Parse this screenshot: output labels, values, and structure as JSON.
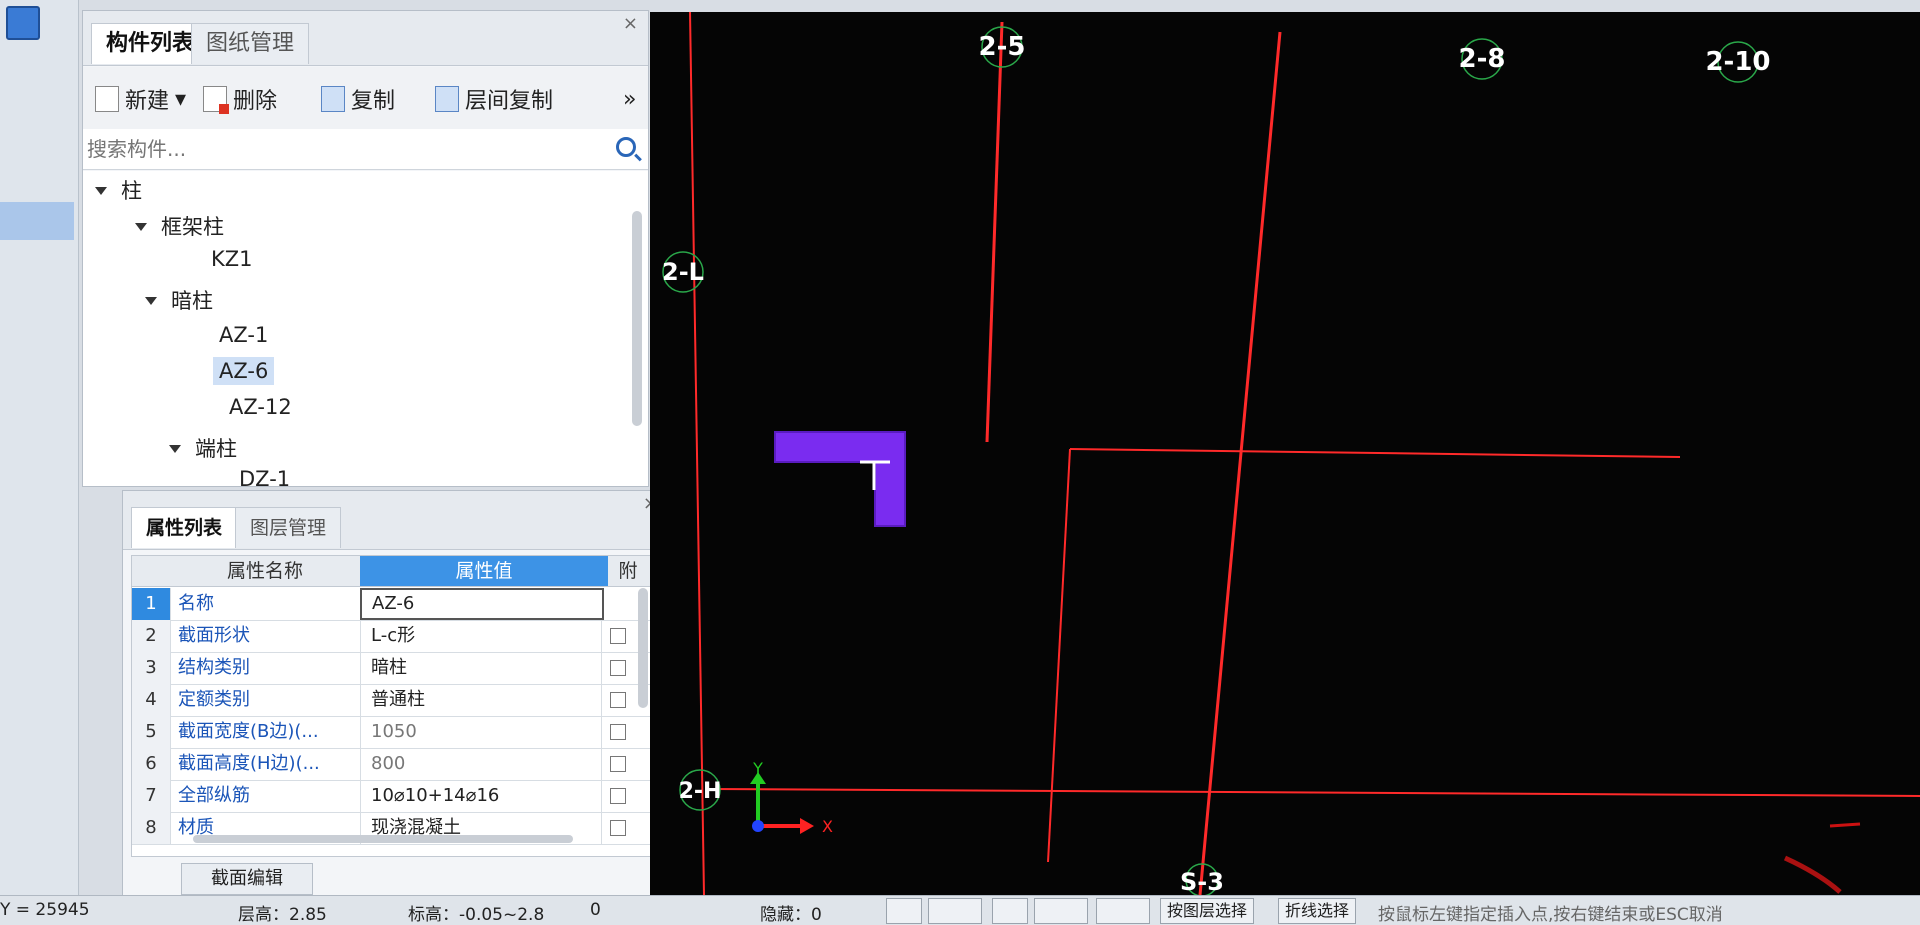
{
  "component_panel": {
    "tabs": [
      {
        "label": "构件列表"
      },
      {
        "label": "图纸管理"
      }
    ],
    "close": "×",
    "toolbar": {
      "new": "新建",
      "delete": "删除",
      "copy": "复制",
      "layer_copy": "层间复制",
      "more": "»"
    },
    "search_placeholder": "搜索构件...",
    "tree": {
      "root": "柱",
      "frame_column": "框架柱",
      "kz1": "KZ1",
      "hidden_column": "暗柱",
      "az1": "AZ-1",
      "az6": "AZ-6",
      "az12": "AZ-12",
      "end_column": "端柱",
      "dz1": "DZ-1"
    }
  },
  "property_panel": {
    "tabs": [
      {
        "label": "属性列表"
      },
      {
        "label": "图层管理"
      }
    ],
    "close": "×",
    "headers": {
      "name": "属性名称",
      "value": "属性值",
      "attach": "附"
    },
    "rows": [
      {
        "num": "1",
        "name": "名称",
        "value": "AZ-6"
      },
      {
        "num": "2",
        "name": "截面形状",
        "value": "L-c形"
      },
      {
        "num": "3",
        "name": "结构类别",
        "value": "暗柱"
      },
      {
        "num": "4",
        "name": "定额类别",
        "value": "普通柱"
      },
      {
        "num": "5",
        "name": "截面宽度(B边)(...",
        "value": "1050"
      },
      {
        "num": "6",
        "name": "截面高度(H边)(...",
        "value": "800"
      },
      {
        "num": "7",
        "name": "全部纵筋",
        "value": "10⌀10+14⌀16"
      },
      {
        "num": "8",
        "name": "材质",
        "value": "现浇混凝土"
      }
    ],
    "section_edit": "截面编辑"
  },
  "canvas": {
    "axis_labels": {
      "a25": "2-5",
      "a28": "2-8",
      "a210": "2-10",
      "a2l": "2-L",
      "a2h": "2-H",
      "s3": "S-3"
    },
    "ucs": {
      "x": "X",
      "y": "Y"
    },
    "colors": {
      "grid": "#ff2a2a",
      "column": "#7a2cf0",
      "background": "#050505"
    }
  },
  "status_bar": {
    "y_coord": "Y = 25945",
    "floor_height": "层高：2.85",
    "elevation": "标高：-0.05~2.8",
    "zero": "0",
    "hidden": "隐藏：0",
    "layer_select": "按图层选择",
    "polyline_select": "折线选择",
    "hint": "按鼠标左键指定插入点,按右键结束或ESC取消"
  }
}
